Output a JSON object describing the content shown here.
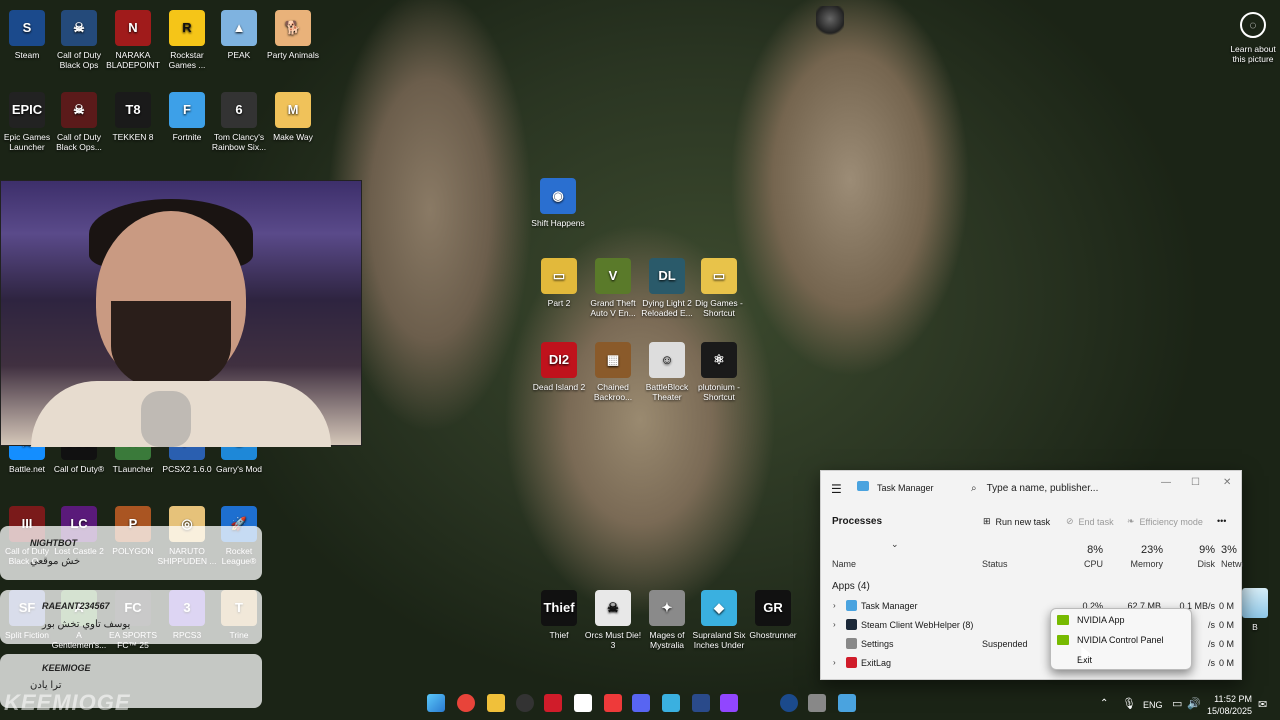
{
  "desktop": {
    "icons": [
      {
        "label": "Steam",
        "color": "#1b4a8c",
        "glyph": "S"
      },
      {
        "label": "Call of Duty Black Ops",
        "color": "#244a7a",
        "glyph": "☠"
      },
      {
        "label": "NARAKA BLADEPOINT",
        "color": "#a01b1b",
        "glyph": "N"
      },
      {
        "label": "Rockstar Games ...",
        "color": "#f5c518",
        "glyph": "R"
      },
      {
        "label": "PEAK",
        "color": "#7fb3e0",
        "glyph": "▲"
      },
      {
        "label": "Party Animals",
        "color": "#e9b27a",
        "glyph": "🐕"
      },
      {
        "label": "Epic Games Launcher",
        "color": "#222222",
        "glyph": "EPIC"
      },
      {
        "label": "Call of Duty Black Ops...",
        "color": "#5b1a1a",
        "glyph": "☠"
      },
      {
        "label": "TEKKEN 8",
        "color": "#1a1a1a",
        "glyph": "T8"
      },
      {
        "label": "Fortnite",
        "color": "#3da0e8",
        "glyph": "F"
      },
      {
        "label": "Tom Clancy's Rainbow Six...",
        "color": "#333333",
        "glyph": "6"
      },
      {
        "label": "Make Way",
        "color": "#f0c25a",
        "glyph": "M"
      },
      {
        "label": "Shift Happens",
        "color": "#2a6fd0",
        "glyph": "◉"
      },
      {
        "label": "Part 2",
        "color": "#e2b93b",
        "glyph": "▭"
      },
      {
        "label": "Grand Theft Auto V En...",
        "color": "#5a7a2a",
        "glyph": "V"
      },
      {
        "label": "Dying Light 2 Reloaded E...",
        "color": "#2a5a6a",
        "glyph": "DL"
      },
      {
        "label": "Dig Games - Shortcut",
        "color": "#e8c34a",
        "glyph": "▭"
      },
      {
        "label": "Dead Island 2",
        "color": "#c0121c",
        "glyph": "DI2"
      },
      {
        "label": "Chained Backroo...",
        "color": "#8a5a2a",
        "glyph": "▦"
      },
      {
        "label": "BattleBlock Theater",
        "color": "#dddddd",
        "glyph": "☺"
      },
      {
        "label": "plutonium - Shortcut",
        "color": "#1a1a1a",
        "glyph": "⚛"
      },
      {
        "label": "Battle.net",
        "color": "#148eff",
        "glyph": "⚔"
      },
      {
        "label": "Call of Duty®",
        "color": "#111111",
        "glyph": "COD"
      },
      {
        "label": "TLauncher",
        "color": "#3a7a3a",
        "glyph": "✕"
      },
      {
        "label": "PCSX2 1.6.0",
        "color": "#2a5fb0",
        "glyph": "P"
      },
      {
        "label": "Garry's Mod",
        "color": "#1e88d8",
        "glyph": "G"
      },
      {
        "label": "Call of Duty Black O...",
        "color": "#7a1a1a",
        "glyph": "III"
      },
      {
        "label": "Lost Castle 2",
        "color": "#5a1a7a",
        "glyph": "LC"
      },
      {
        "label": "POLYGON",
        "color": "#aa5522",
        "glyph": "P"
      },
      {
        "label": "NARUTO SHIPPUDEN ...",
        "color": "#e6c27a",
        "glyph": "◎"
      },
      {
        "label": "Rocket League®",
        "color": "#1e6fd0",
        "glyph": "🚀"
      },
      {
        "label": "Split Fiction",
        "color": "#6a7ab0",
        "glyph": "SF"
      },
      {
        "label": "A Gentlemen's...",
        "color": "#5a8a4a",
        "glyph": "A"
      },
      {
        "label": "EA SPORTS FC™ 25",
        "color": "#2a2a2a",
        "glyph": "FC"
      },
      {
        "label": "RPCS3",
        "color": "#7a5ad0",
        "glyph": "3"
      },
      {
        "label": "Trine",
        "color": "#c7a56a",
        "glyph": "T"
      },
      {
        "label": "Thief",
        "color": "#111111",
        "glyph": "Thief"
      },
      {
        "label": "Orcs Must Die! 3",
        "color": "#e8e8e8",
        "glyph": "☠"
      },
      {
        "label": "Mages of Mystralia",
        "color": "#8a8a8a",
        "glyph": "✦"
      },
      {
        "label": "Supraland Six Inches Under",
        "color": "#3ab0e0",
        "glyph": "◆"
      },
      {
        "label": "Ghostrunner",
        "color": "#111111",
        "glyph": "GR"
      }
    ],
    "learn_label": "Learn about this picture",
    "recycle_label": "B"
  },
  "chat": {
    "entries": [
      {
        "name": "NIGHTBOT",
        "message": "خش موقعي"
      },
      {
        "name": "RAEANT234567",
        "message": "يوسف تاوي تخش بور"
      },
      {
        "name": "KEEMIOGE",
        "message": "ترا يادن"
      }
    ],
    "overlay_text": "KEEMIOGE"
  },
  "task_manager": {
    "title": "Task Manager",
    "search_placeholder": "Type a name, publisher...",
    "section": "Processes",
    "run_new_task": "Run new task",
    "end_task": "End task",
    "efficiency_mode": "Efficiency mode",
    "more": "•••",
    "columns": {
      "name": "Name",
      "status": "Status",
      "cpu_pct": "8%",
      "cpu": "CPU",
      "mem_pct": "23%",
      "mem": "Memory",
      "disk_pct": "9%",
      "disk": "Disk",
      "net_pct": "3%",
      "net": "Network"
    },
    "group": "Apps (4)",
    "rows": [
      {
        "name": "Task Manager",
        "status": "",
        "cpu": "0.2%",
        "mem": "62.7 MB",
        "disk": "0.1 MB/s",
        "net": "0 M",
        "color": "#4aa3df",
        "expand": "›"
      },
      {
        "name": "Steam Client WebHelper (8)",
        "status": "",
        "cpu": "",
        "mem": "",
        "disk": "/s",
        "net": "0 M",
        "color": "#1b2838",
        "expand": "›"
      },
      {
        "name": "Settings",
        "status": "Suspended",
        "cpu": "",
        "mem": "",
        "disk": "/s",
        "net": "0 M",
        "color": "#888888",
        "expand": ""
      },
      {
        "name": "ExitLag",
        "status": "",
        "cpu": "",
        "mem": "",
        "disk": "/s",
        "net": "0 M",
        "color": "#d01c2a",
        "expand": "›"
      }
    ]
  },
  "context_menu": {
    "items": [
      "NVIDIA App",
      "NVIDIA Control Panel",
      "Exit"
    ]
  },
  "taskbar": {
    "apps": [
      {
        "name": "start",
        "color": "#2aa0f0"
      },
      {
        "name": "chrome",
        "color": "#e8443a"
      },
      {
        "name": "file-explorer",
        "color": "#f0c03a"
      },
      {
        "name": "obs",
        "color": "#333333"
      },
      {
        "name": "exitlag",
        "color": "#d01c2a"
      },
      {
        "name": "capcut",
        "color": "#ffffff"
      },
      {
        "name": "media",
        "color": "#ee3a3a"
      },
      {
        "name": "discord",
        "color": "#5865f2"
      },
      {
        "name": "notepad",
        "color": "#3ab0e0"
      },
      {
        "name": "app",
        "color": "#2a4a8a"
      },
      {
        "name": "twitch",
        "color": "#9146ff"
      },
      {
        "name": "steam",
        "color": "#1b4a8c"
      },
      {
        "name": "settings",
        "color": "#888888"
      },
      {
        "name": "task-manager",
        "color": "#4aa3df"
      }
    ],
    "language": "ENG",
    "time": "11:52 PM",
    "date": "15/08/2025"
  }
}
